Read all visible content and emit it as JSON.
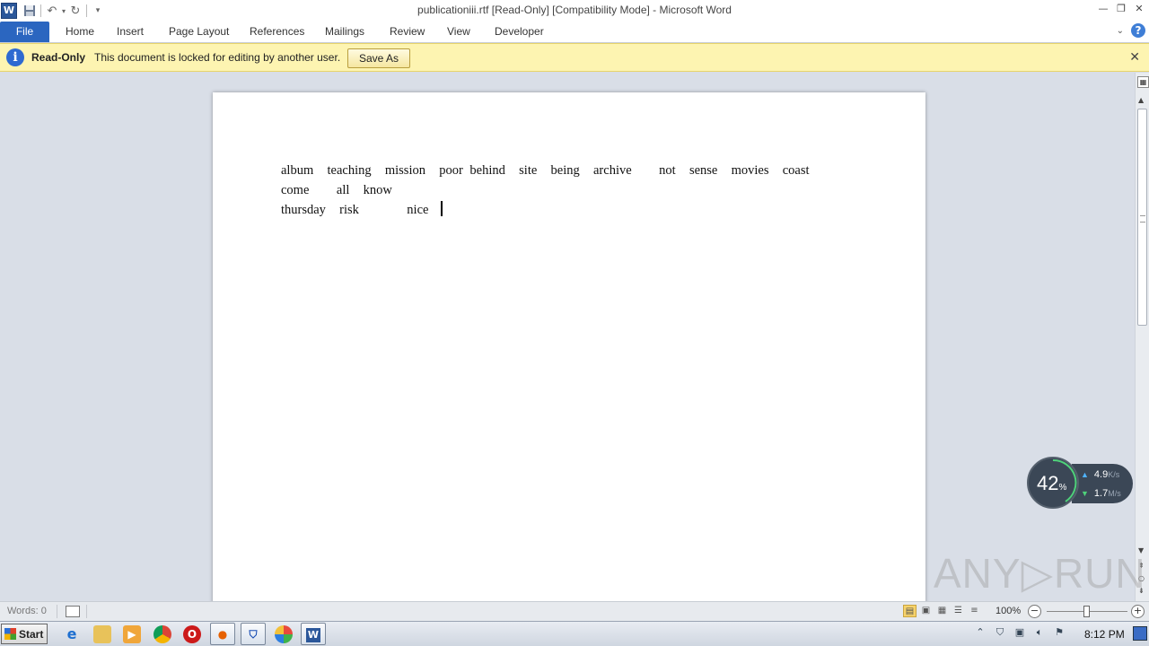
{
  "window": {
    "title": "publicationiii.rtf [Read-Only] [Compatibility Mode]  -  Microsoft Word",
    "app_icon_letter": "W"
  },
  "quick_access": {
    "save_icon": "save-icon",
    "undo_icon": "undo-icon",
    "redo_icon": "redo-icon",
    "customize_icon": "customize-arrow-icon"
  },
  "ribbon_tabs": [
    {
      "label": "File",
      "active": true
    },
    {
      "label": "Home"
    },
    {
      "label": "Insert"
    },
    {
      "label": "Page Layout"
    },
    {
      "label": "References"
    },
    {
      "label": "Mailings"
    },
    {
      "label": "Review"
    },
    {
      "label": "View"
    },
    {
      "label": "Developer"
    }
  ],
  "message_bar": {
    "title": "Read-Only",
    "text": "This document is locked for editing by another user.",
    "button_label": "Save As",
    "close_glyph": "✕"
  },
  "document": {
    "line1": "album  teaching  mission  poor behind  site  being  archive    not  sense  movies  coast come    all  know",
    "line2": "thursday  risk       nice "
  },
  "network_widget": {
    "percent": "42",
    "percent_unit": "%",
    "upload_value": "4.9",
    "upload_unit": "K/s",
    "download_value": "1.7",
    "download_unit": "M/s"
  },
  "watermark": "ANY▷RUN",
  "status_bar": {
    "words": "Words: 0",
    "zoom": "100%"
  },
  "taskbar": {
    "start_label": "Start",
    "clock": "8:12 PM"
  },
  "colors": {
    "file_tab": "#2b66c0",
    "message_bar": "#fdf4b1",
    "page_background": "#d9dee7"
  }
}
